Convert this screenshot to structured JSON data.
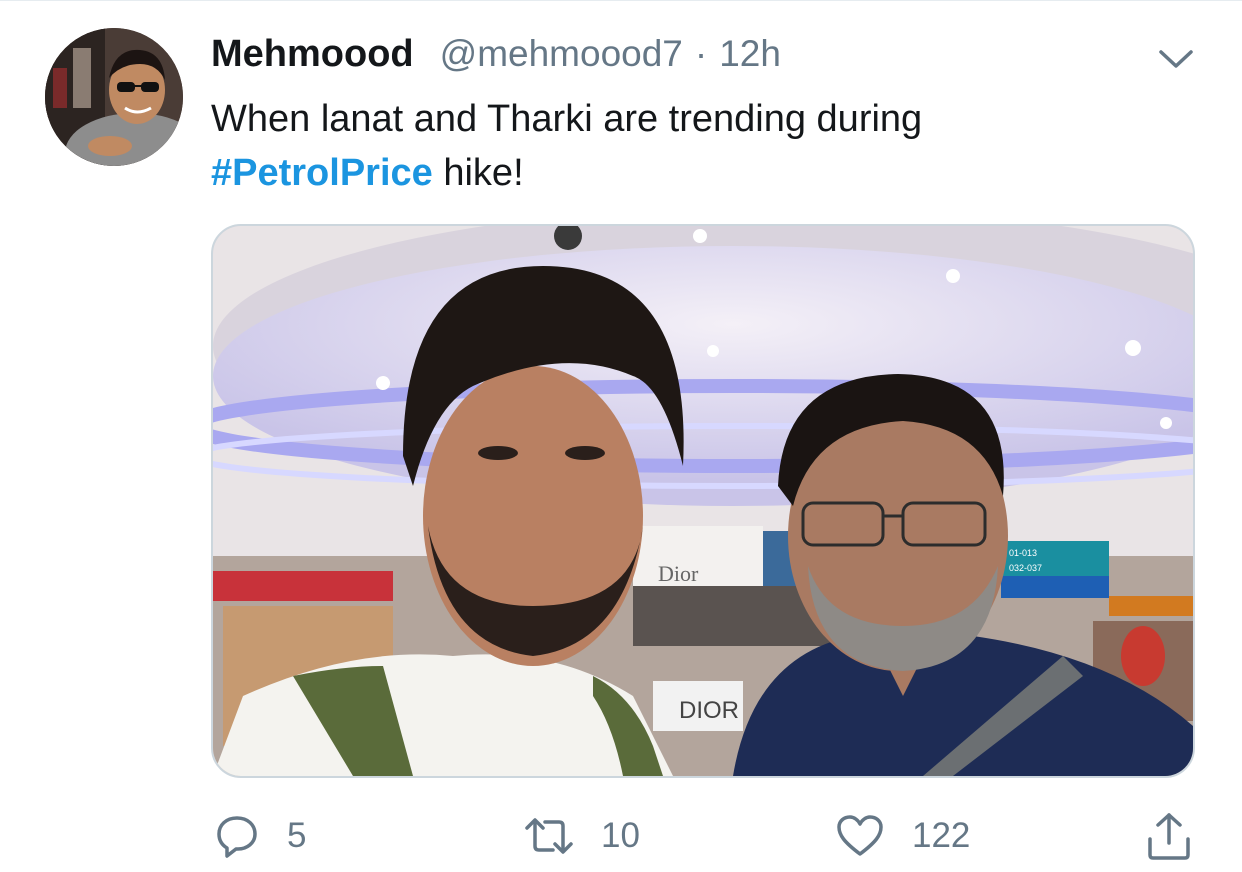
{
  "tweet": {
    "display_name": "Mehmoood",
    "handle": "@mehmoood7",
    "separator": "·",
    "time": "12h",
    "text_line1": "When lanat and Tharki are trending during",
    "hashtag": "#PetrolPrice",
    "text_suffix": " hike!",
    "menu_icon": "chevron-down-icon",
    "media": {
      "store_sign": "DIOR",
      "wall_sign": "Dior",
      "gate_sign_line1": "01-013",
      "gate_sign_line2": "032-037"
    }
  },
  "actions": {
    "replies": "5",
    "retweets": "10",
    "likes": "122",
    "reply_icon": "reply-icon",
    "retweet_icon": "retweet-icon",
    "like_icon": "heart-icon",
    "share_icon": "share-icon"
  },
  "colors": {
    "text_primary": "#14171a",
    "text_secondary": "#657786",
    "hashtag": "#1b95e0",
    "border": "#ccd6dd"
  }
}
